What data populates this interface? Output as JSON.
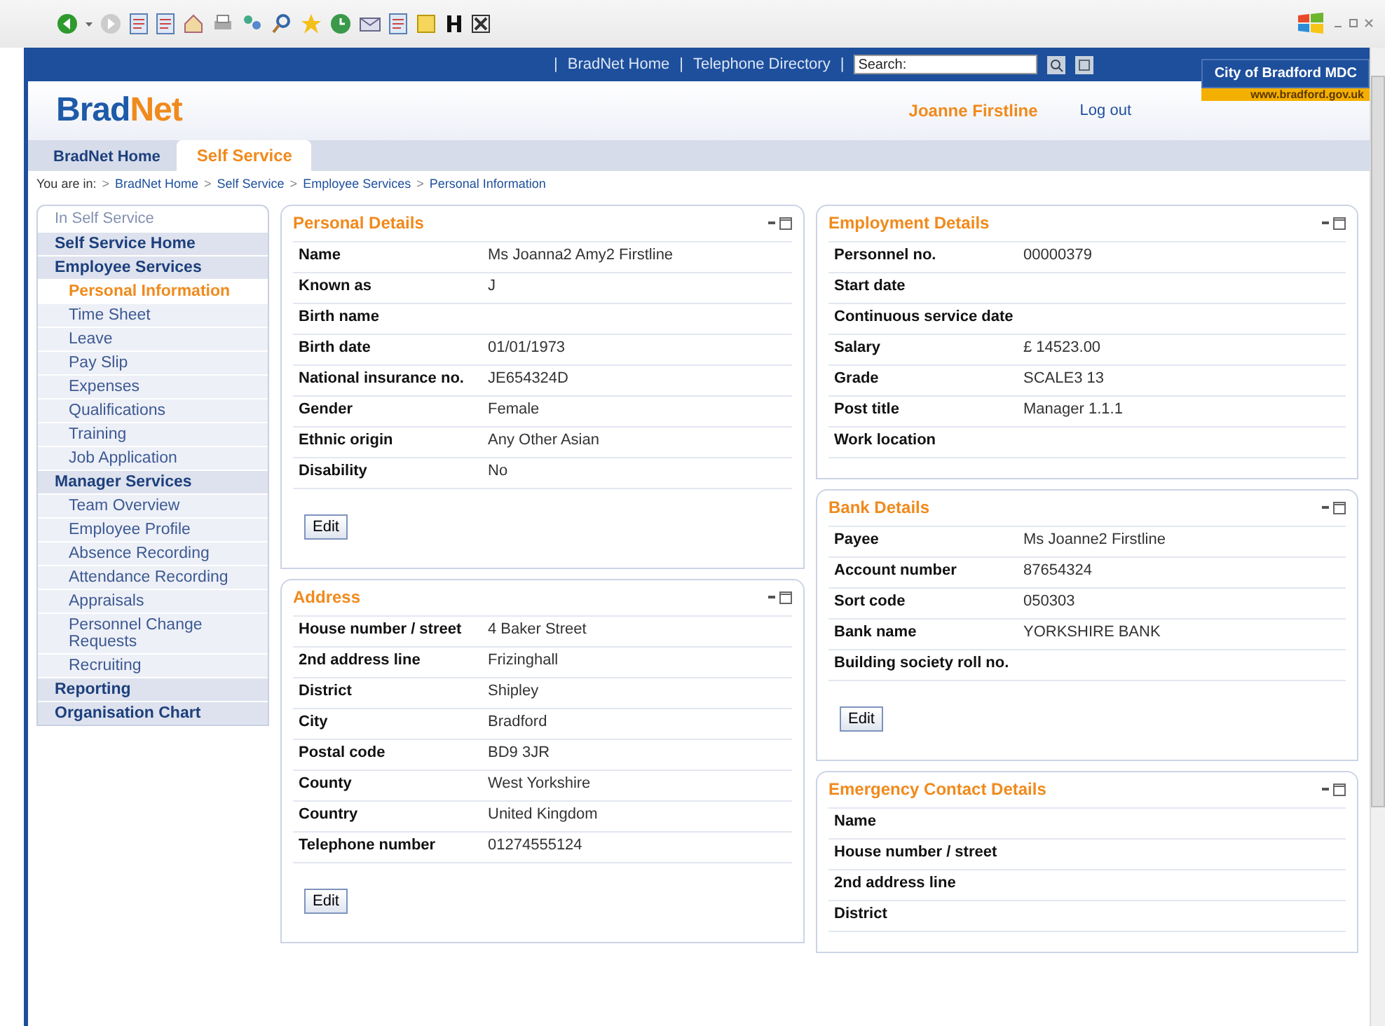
{
  "top_bar": {
    "links": [
      "BradNet Home",
      "Telephone Directory"
    ],
    "separator": "|",
    "search": {
      "placeholder": "Search:"
    },
    "council": {
      "name": "City of Bradford MDC",
      "url": "www.bradford.gov.uk"
    }
  },
  "header": {
    "logo": {
      "first": "Brad",
      "second": "Net"
    },
    "user": "Joanne Firstline",
    "logout": "Log out"
  },
  "tabs": [
    {
      "label": "BradNet Home",
      "selected": false
    },
    {
      "label": "Self Service",
      "selected": true
    }
  ],
  "breadcrumb": {
    "prefix": "You are in:",
    "separator": ">",
    "items": [
      "BradNet Home",
      "Self Service",
      "Employee Services",
      "Personal Information"
    ]
  },
  "sidebar": {
    "title": "In Self Service",
    "items": [
      {
        "kind": "heading",
        "label": "Self Service Home",
        "selected": false
      },
      {
        "kind": "heading",
        "label": "Employee Services",
        "selected": false
      },
      {
        "kind": "link",
        "label": "Personal Information",
        "selected": true
      },
      {
        "kind": "link",
        "label": "Time Sheet",
        "selected": false
      },
      {
        "kind": "link",
        "label": "Leave",
        "selected": false
      },
      {
        "kind": "link",
        "label": "Pay Slip",
        "selected": false
      },
      {
        "kind": "link",
        "label": "Expenses",
        "selected": false
      },
      {
        "kind": "link",
        "label": "Qualifications",
        "selected": false
      },
      {
        "kind": "link",
        "label": "Training",
        "selected": false
      },
      {
        "kind": "link",
        "label": "Job Application",
        "selected": false
      },
      {
        "kind": "heading",
        "label": "Manager Services",
        "selected": false
      },
      {
        "kind": "link",
        "label": "Team Overview",
        "selected": false
      },
      {
        "kind": "link",
        "label": "Employee Profile",
        "selected": false
      },
      {
        "kind": "link",
        "label": "Absence Recording",
        "selected": false
      },
      {
        "kind": "link",
        "label": "Attendance Recording",
        "selected": false
      },
      {
        "kind": "link",
        "label": "Appraisals",
        "selected": false
      },
      {
        "kind": "link",
        "label": "Personnel Change Requests",
        "selected": false
      },
      {
        "kind": "link",
        "label": "Recruiting",
        "selected": false
      },
      {
        "kind": "heading",
        "label": "Reporting",
        "selected": false
      },
      {
        "kind": "heading",
        "label": "Organisation Chart",
        "selected": false
      }
    ]
  },
  "columns": [
    [
      {
        "title": "Personal Details",
        "rows": [
          {
            "label": "Name",
            "value": "Ms Joanna2 Amy2 Firstline"
          },
          {
            "label": "Known as",
            "value": "J"
          },
          {
            "label": "Birth name",
            "value": ""
          },
          {
            "label": "Birth date",
            "value": "01/01/1973"
          },
          {
            "label": "National insurance no.",
            "value": "JE654324D"
          },
          {
            "label": "Gender",
            "value": "Female"
          },
          {
            "label": "Ethnic origin",
            "value": "Any Other Asian"
          },
          {
            "label": "Disability",
            "value": "No"
          }
        ],
        "button": "Edit"
      },
      {
        "title": "Address",
        "rows": [
          {
            "label": "House number / street",
            "value": "4 Baker Street"
          },
          {
            "label": "2nd address line",
            "value": "Frizinghall"
          },
          {
            "label": "District",
            "value": "Shipley"
          },
          {
            "label": "City",
            "value": "Bradford"
          },
          {
            "label": "Postal code",
            "value": "BD9 3JR"
          },
          {
            "label": "County",
            "value": "West Yorkshire"
          },
          {
            "label": "Country",
            "value": "United Kingdom"
          },
          {
            "label": "Telephone number",
            "value": "01274555124"
          }
        ],
        "button": "Edit"
      }
    ],
    [
      {
        "title": "Employment Details",
        "rows": [
          {
            "label": "Personnel no.",
            "value": "00000379"
          },
          {
            "label": "Start date",
            "value": ""
          },
          {
            "label": "Continuous service date",
            "value": ""
          },
          {
            "label": "Salary",
            "value": "£ 14523.00"
          },
          {
            "label": "Grade",
            "value": "SCALE3   13"
          },
          {
            "label": "Post title",
            "value": "Manager 1.1.1"
          },
          {
            "label": "Work location",
            "value": ""
          }
        ]
      },
      {
        "title": "Bank Details",
        "rows": [
          {
            "label": "Payee",
            "value": "Ms Joanne2 Firstline"
          },
          {
            "label": "Account number",
            "value": "87654324"
          },
          {
            "label": "Sort code",
            "value": "050303"
          },
          {
            "label": "Bank name",
            "value": "YORKSHIRE BANK"
          },
          {
            "label": "Building society roll no.",
            "value": ""
          }
        ],
        "button": "Edit"
      },
      {
        "title": "Emergency Contact Details",
        "rows": [
          {
            "label": "Name",
            "value": ""
          },
          {
            "label": "House number / street",
            "value": ""
          },
          {
            "label": "2nd address line",
            "value": ""
          },
          {
            "label": "District",
            "value": ""
          }
        ]
      }
    ]
  ]
}
